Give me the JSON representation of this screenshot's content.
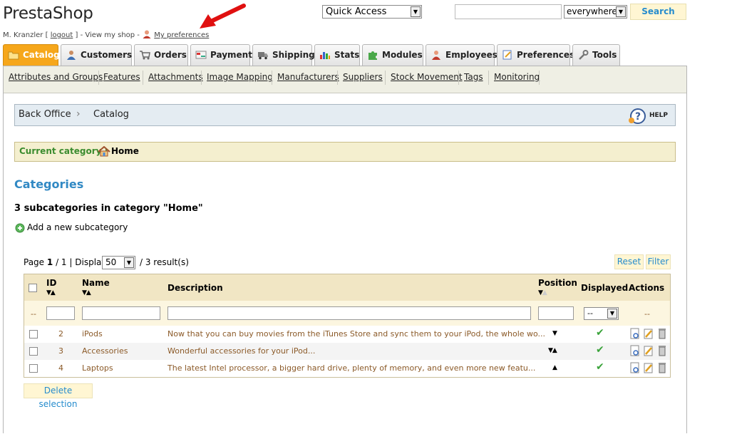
{
  "header": {
    "logo": "PrestaShop",
    "user_name": "M. Kranzler",
    "logout": "logout",
    "view_shop": "View my shop",
    "my_preferences": "My preferences",
    "quick_access": "Quick Access",
    "search_value": "",
    "search_scope": "everywhere",
    "search_button": "Search"
  },
  "tabs": [
    {
      "label": "Catalog",
      "icon": "catalog-icon",
      "active": true
    },
    {
      "label": "Customers",
      "icon": "customers-icon"
    },
    {
      "label": "Orders",
      "icon": "orders-icon"
    },
    {
      "label": "Payment",
      "icon": "payment-icon"
    },
    {
      "label": "Shipping",
      "icon": "shipping-icon"
    },
    {
      "label": "Stats",
      "icon": "stats-icon"
    },
    {
      "label": "Modules",
      "icon": "modules-icon"
    },
    {
      "label": "Employees",
      "icon": "employees-icon"
    },
    {
      "label": "Preferences",
      "icon": "preferences-icon"
    },
    {
      "label": "Tools",
      "icon": "tools-icon"
    }
  ],
  "subnav": [
    "Attributes and Groups",
    "Features",
    "Attachments",
    "Image Mapping",
    "Manufacturers",
    "Suppliers",
    "Stock Movement",
    "Tags",
    "Monitoring"
  ],
  "breadcrumb": {
    "root": "Back Office",
    "current": "Catalog",
    "help": "HELP"
  },
  "current_category": {
    "label": "Current category :",
    "value": "Home"
  },
  "section_title": "Categories",
  "subcategory_count": "3 subcategories in category \"Home\"",
  "add_subcategory": "Add a new subcategory",
  "pagination": {
    "page_label": "Page",
    "page": "1",
    "pages": "/ 1",
    "display_label": "| Display",
    "page_size": "50",
    "results": "/ 3 result(s)"
  },
  "buttons": {
    "reset": "Reset",
    "filter": "Filter",
    "delete_selection": "Delete selection"
  },
  "table": {
    "columns": {
      "id": "ID",
      "name": "Name",
      "description": "Description",
      "position": "Position",
      "displayed": "Displayed",
      "actions": "Actions"
    },
    "filter_placeholder": "--",
    "displayed_filter": "--",
    "rows": [
      {
        "id": "2",
        "name": "iPods",
        "description": "Now that you can buy movies from the iTunes Store and sync them to your iPod, the whole wo...",
        "position": "down",
        "displayed": true
      },
      {
        "id": "3",
        "name": "Accessories",
        "description": "Wonderful accessories for your iPod...",
        "position": "both",
        "displayed": true
      },
      {
        "id": "4",
        "name": "Laptops",
        "description": "The latest Intel processor, a bigger hard drive, plenty of memory, and even more new featu...",
        "position": "up",
        "displayed": true
      }
    ]
  },
  "colors": {
    "accent": "#f6a71b",
    "link": "#268ccd",
    "title": "#3189c4",
    "green": "#3b8c2f"
  }
}
